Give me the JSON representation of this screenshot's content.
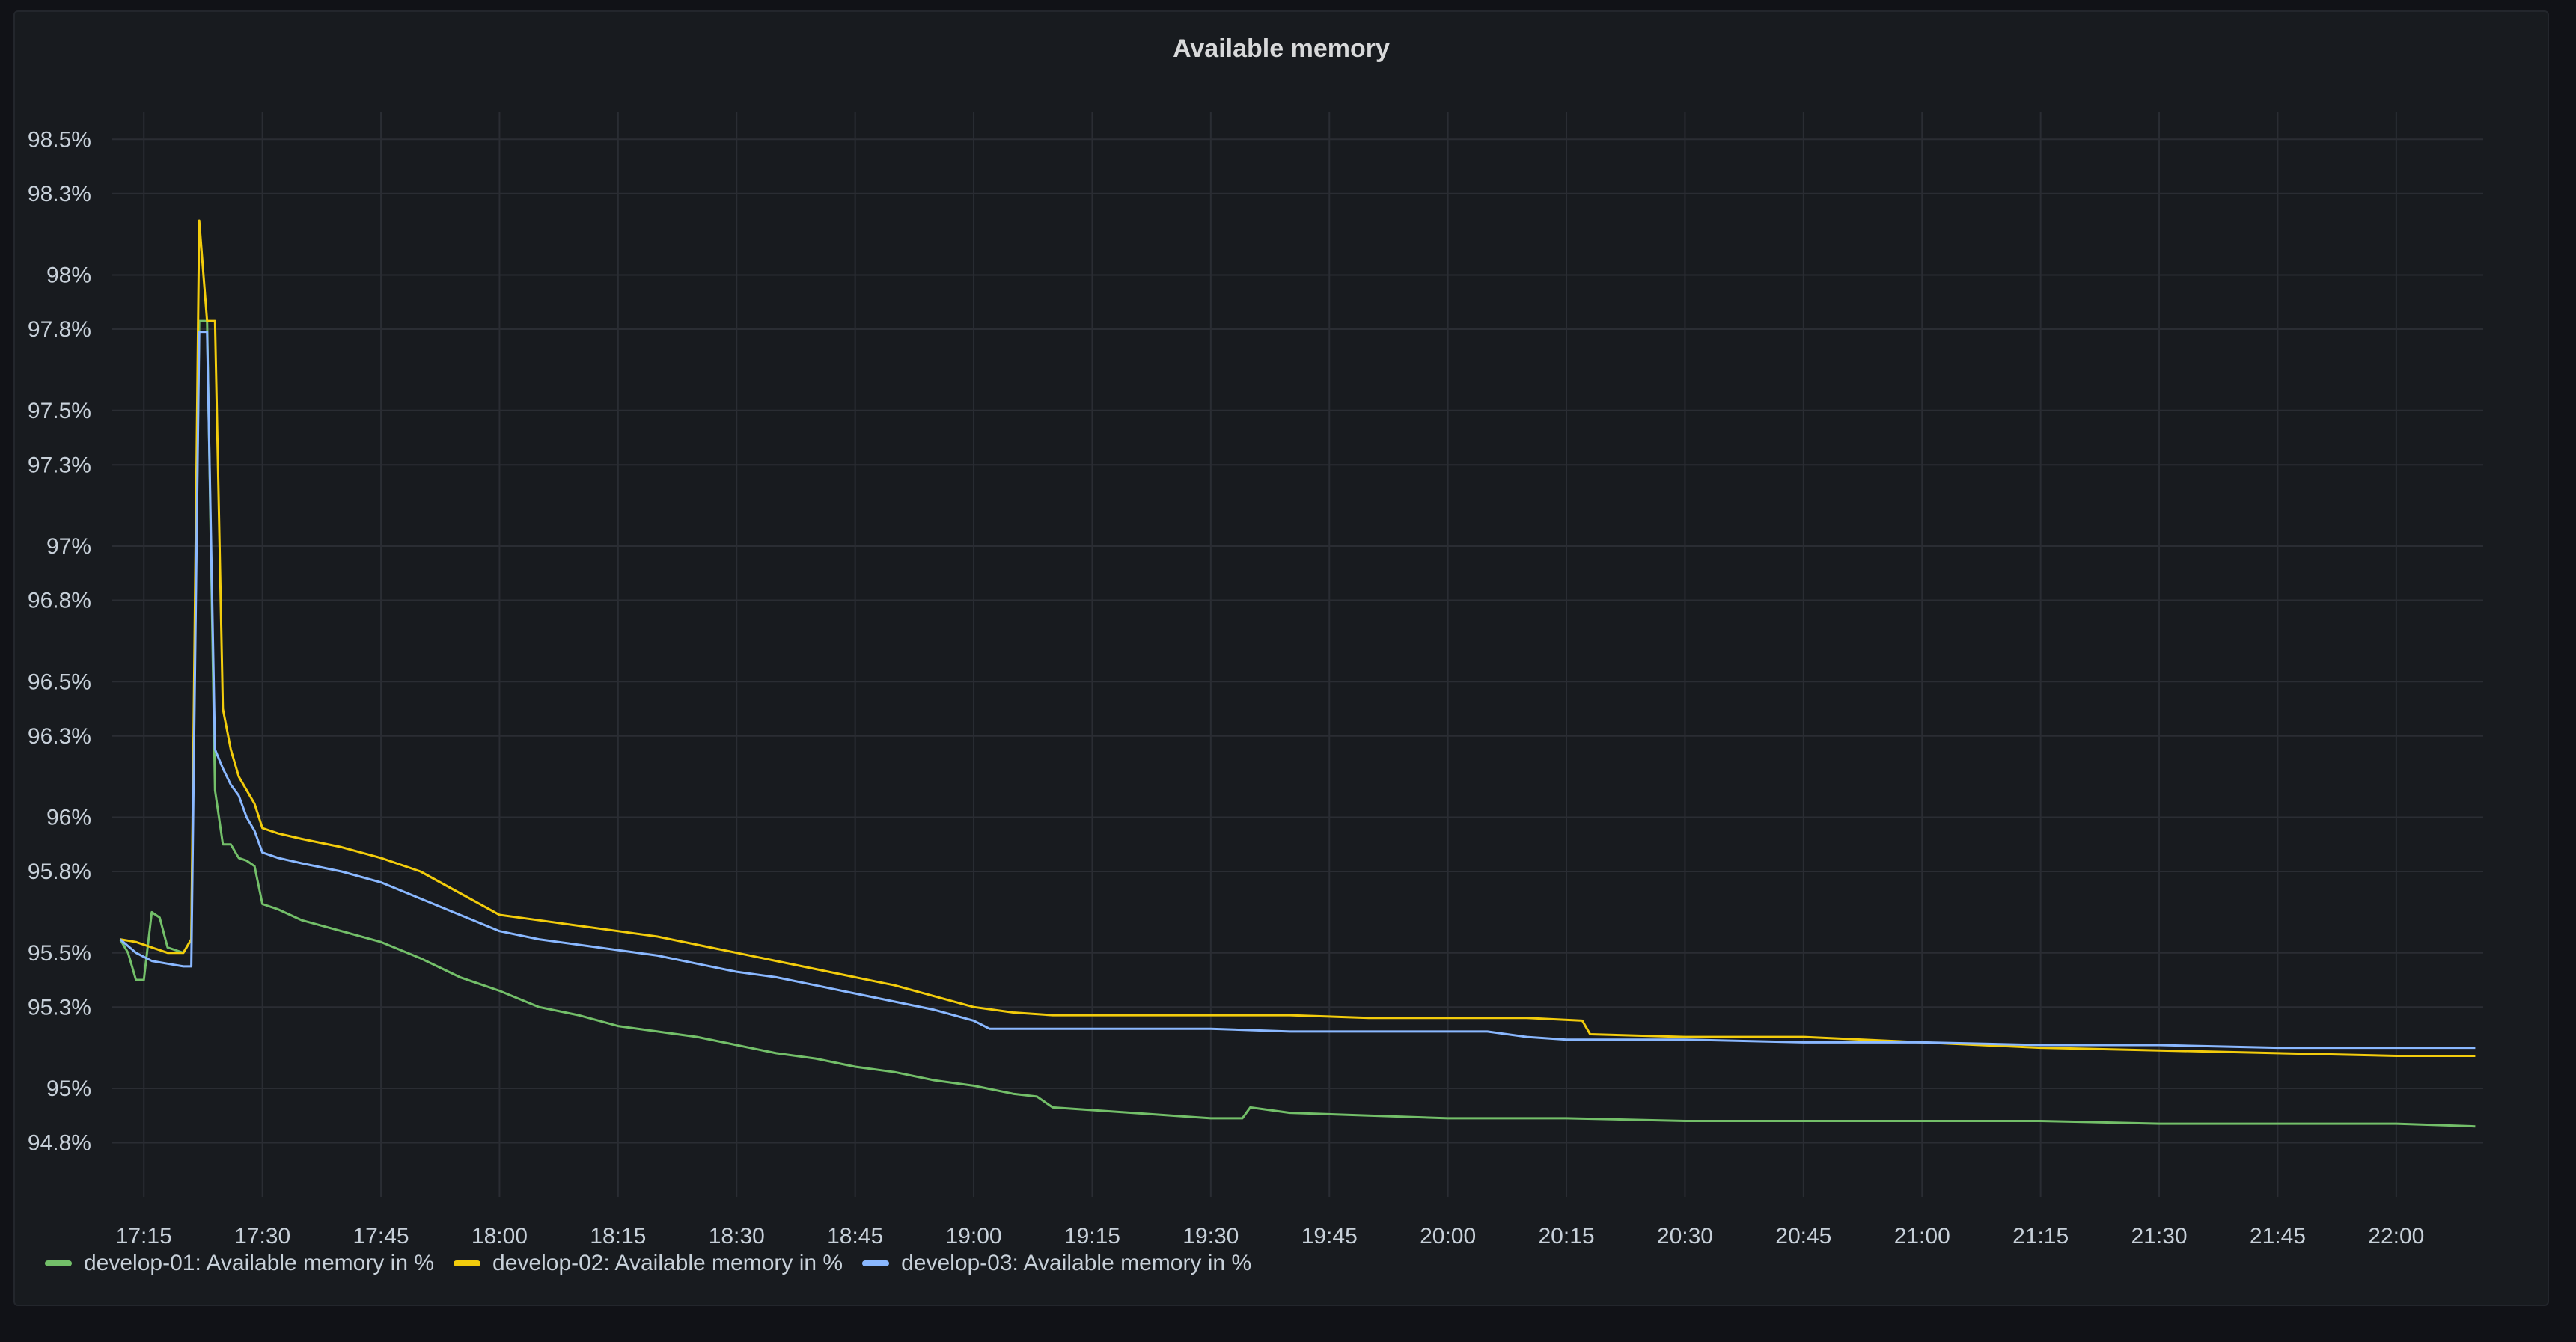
{
  "panel": {
    "title": "Available memory"
  },
  "chart_data": {
    "type": "line",
    "title": "Available memory",
    "xlabel": "",
    "ylabel": "",
    "x_ticks": [
      "17:15",
      "17:30",
      "17:45",
      "18:00",
      "18:15",
      "18:30",
      "18:45",
      "19:00",
      "19:15",
      "19:30",
      "19:45",
      "20:00",
      "20:15",
      "20:30",
      "20:45",
      "21:00",
      "21:15",
      "21:30",
      "21:45",
      "22:00"
    ],
    "y_ticks": [
      "94.8%",
      "95%",
      "95.3%",
      "95.5%",
      "95.8%",
      "96%",
      "96.3%",
      "96.5%",
      "96.8%",
      "97%",
      "97.3%",
      "97.5%",
      "97.8%",
      "98%",
      "98.3%",
      "98.5%"
    ],
    "xlim": [
      "17:11",
      "22:11"
    ],
    "ylim": [
      94.6,
      98.6
    ],
    "grid": true,
    "legend_position": "bottom-left",
    "series": [
      {
        "name": "develop-01: Available memory in %",
        "color": "#73bf69",
        "points": [
          [
            "17:12",
            95.55
          ],
          [
            "17:13",
            95.5
          ],
          [
            "17:14",
            95.4
          ],
          [
            "17:15",
            95.4
          ],
          [
            "17:16",
            95.65
          ],
          [
            "17:17",
            95.63
          ],
          [
            "17:18",
            95.52
          ],
          [
            "17:20",
            95.5
          ],
          [
            "17:21",
            95.55
          ],
          [
            "17:22",
            97.83
          ],
          [
            "17:23",
            97.83
          ],
          [
            "17:24",
            96.1
          ],
          [
            "17:25",
            95.9
          ],
          [
            "17:26",
            95.9
          ],
          [
            "17:27",
            95.85
          ],
          [
            "17:28",
            95.84
          ],
          [
            "17:29",
            95.82
          ],
          [
            "17:30",
            95.68
          ],
          [
            "17:32",
            95.66
          ],
          [
            "17:35",
            95.62
          ],
          [
            "17:40",
            95.58
          ],
          [
            "17:45",
            95.54
          ],
          [
            "17:50",
            95.48
          ],
          [
            "17:55",
            95.41
          ],
          [
            "18:00",
            95.36
          ],
          [
            "18:05",
            95.3
          ],
          [
            "18:10",
            95.27
          ],
          [
            "18:15",
            95.23
          ],
          [
            "18:20",
            95.21
          ],
          [
            "18:25",
            95.19
          ],
          [
            "18:30",
            95.16
          ],
          [
            "18:35",
            95.13
          ],
          [
            "18:40",
            95.11
          ],
          [
            "18:45",
            95.08
          ],
          [
            "18:50",
            95.06
          ],
          [
            "18:55",
            95.03
          ],
          [
            "19:00",
            95.01
          ],
          [
            "19:05",
            94.98
          ],
          [
            "19:08",
            94.97
          ],
          [
            "19:10",
            94.93
          ],
          [
            "19:15",
            94.92
          ],
          [
            "19:20",
            94.91
          ],
          [
            "19:25",
            94.9
          ],
          [
            "19:30",
            94.89
          ],
          [
            "19:34",
            94.89
          ],
          [
            "19:35",
            94.93
          ],
          [
            "19:40",
            94.91
          ],
          [
            "19:50",
            94.9
          ],
          [
            "20:00",
            94.89
          ],
          [
            "20:15",
            94.89
          ],
          [
            "20:30",
            94.88
          ],
          [
            "20:45",
            94.88
          ],
          [
            "21:00",
            94.88
          ],
          [
            "21:15",
            94.88
          ],
          [
            "21:30",
            94.87
          ],
          [
            "21:45",
            94.87
          ],
          [
            "22:00",
            94.87
          ],
          [
            "22:10",
            94.86
          ]
        ]
      },
      {
        "name": "develop-02: Available memory in %",
        "color": "#f2cc0c",
        "points": [
          [
            "17:12",
            95.55
          ],
          [
            "17:14",
            95.54
          ],
          [
            "17:16",
            95.52
          ],
          [
            "17:18",
            95.5
          ],
          [
            "17:20",
            95.5
          ],
          [
            "17:21",
            95.55
          ],
          [
            "17:22",
            98.2
          ],
          [
            "17:23",
            97.83
          ],
          [
            "17:24",
            97.83
          ],
          [
            "17:25",
            96.4
          ],
          [
            "17:26",
            96.25
          ],
          [
            "17:27",
            96.15
          ],
          [
            "17:28",
            96.1
          ],
          [
            "17:29",
            96.05
          ],
          [
            "17:30",
            95.96
          ],
          [
            "17:32",
            95.94
          ],
          [
            "17:35",
            95.92
          ],
          [
            "17:40",
            95.89
          ],
          [
            "17:45",
            95.85
          ],
          [
            "17:50",
            95.8
          ],
          [
            "17:55",
            95.72
          ],
          [
            "18:00",
            95.64
          ],
          [
            "18:05",
            95.62
          ],
          [
            "18:10",
            95.6
          ],
          [
            "18:15",
            95.58
          ],
          [
            "18:20",
            95.56
          ],
          [
            "18:25",
            95.53
          ],
          [
            "18:30",
            95.5
          ],
          [
            "18:35",
            95.47
          ],
          [
            "18:40",
            95.44
          ],
          [
            "18:45",
            95.41
          ],
          [
            "18:50",
            95.38
          ],
          [
            "18:55",
            95.34
          ],
          [
            "19:00",
            95.3
          ],
          [
            "19:05",
            95.28
          ],
          [
            "19:10",
            95.27
          ],
          [
            "19:15",
            95.27
          ],
          [
            "19:20",
            95.27
          ],
          [
            "19:30",
            95.27
          ],
          [
            "19:40",
            95.27
          ],
          [
            "19:50",
            95.26
          ],
          [
            "20:00",
            95.26
          ],
          [
            "20:10",
            95.26
          ],
          [
            "20:17",
            95.25
          ],
          [
            "20:18",
            95.2
          ],
          [
            "20:30",
            95.19
          ],
          [
            "20:45",
            95.19
          ],
          [
            "21:00",
            95.17
          ],
          [
            "21:15",
            95.15
          ],
          [
            "21:30",
            95.14
          ],
          [
            "21:45",
            95.13
          ],
          [
            "22:00",
            95.12
          ],
          [
            "22:10",
            95.12
          ]
        ]
      },
      {
        "name": "develop-03: Available memory in %",
        "color": "#8ab8ff",
        "points": [
          [
            "17:12",
            95.55
          ],
          [
            "17:14",
            95.5
          ],
          [
            "17:16",
            95.47
          ],
          [
            "17:18",
            95.46
          ],
          [
            "17:20",
            95.45
          ],
          [
            "17:21",
            95.45
          ],
          [
            "17:22",
            97.79
          ],
          [
            "17:23",
            97.79
          ],
          [
            "17:24",
            96.25
          ],
          [
            "17:25",
            96.18
          ],
          [
            "17:26",
            96.12
          ],
          [
            "17:27",
            96.08
          ],
          [
            "17:28",
            96.0
          ],
          [
            "17:29",
            95.95
          ],
          [
            "17:30",
            95.87
          ],
          [
            "17:32",
            95.85
          ],
          [
            "17:35",
            95.83
          ],
          [
            "17:40",
            95.8
          ],
          [
            "17:45",
            95.76
          ],
          [
            "17:50",
            95.7
          ],
          [
            "17:55",
            95.64
          ],
          [
            "18:00",
            95.58
          ],
          [
            "18:05",
            95.55
          ],
          [
            "18:10",
            95.53
          ],
          [
            "18:15",
            95.51
          ],
          [
            "18:20",
            95.49
          ],
          [
            "18:25",
            95.46
          ],
          [
            "18:30",
            95.43
          ],
          [
            "18:35",
            95.41
          ],
          [
            "18:40",
            95.38
          ],
          [
            "18:45",
            95.35
          ],
          [
            "18:50",
            95.32
          ],
          [
            "18:55",
            95.29
          ],
          [
            "19:00",
            95.25
          ],
          [
            "19:02",
            95.22
          ],
          [
            "19:05",
            95.22
          ],
          [
            "19:10",
            95.22
          ],
          [
            "19:20",
            95.22
          ],
          [
            "19:30",
            95.22
          ],
          [
            "19:40",
            95.21
          ],
          [
            "19:50",
            95.21
          ],
          [
            "20:00",
            95.21
          ],
          [
            "20:05",
            95.21
          ],
          [
            "20:10",
            95.19
          ],
          [
            "20:15",
            95.18
          ],
          [
            "20:30",
            95.18
          ],
          [
            "20:45",
            95.17
          ],
          [
            "21:00",
            95.17
          ],
          [
            "21:15",
            95.16
          ],
          [
            "21:30",
            95.16
          ],
          [
            "21:45",
            95.15
          ],
          [
            "22:00",
            95.15
          ],
          [
            "22:10",
            95.15
          ]
        ]
      }
    ]
  }
}
